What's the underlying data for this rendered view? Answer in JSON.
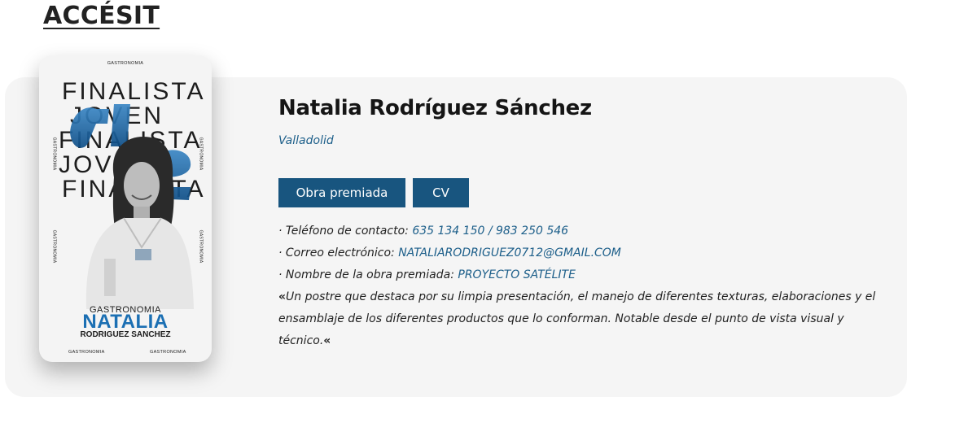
{
  "section": {
    "title": "ACCÉSIT"
  },
  "poster": {
    "top_label": "GASTRONOMIA",
    "words": [
      "FINALISTA",
      "JOVEN",
      "FINALISTA",
      "JOVEN",
      "FINALISTA"
    ],
    "side_label": "GASTRONOMIA",
    "category": "GASTRONOMIA",
    "first_name": "NATALIA",
    "last_name": "RODRIGUEZ SANCHEZ",
    "bottom_left": "GASTRONOMIA",
    "bottom_right": "GASTRONOMIA"
  },
  "person": {
    "name": "Natalia Rodríguez Sánchez",
    "city": "Valladolid"
  },
  "buttons": {
    "obra": "Obra premiada",
    "cv": "CV"
  },
  "details": {
    "phone_label": "· Teléfono de contacto:",
    "phone_value": "635 134 150 / 983 250 546",
    "email_label": "· Correo electrónico:",
    "email_value": "NATALIARODRIGUEZ0712@GMAIL.COM",
    "work_label": "· Nombre de la obra premiada:",
    "work_value": "PROYECTO SATÉLITE"
  },
  "quote": {
    "open": "«",
    "text": "Un postre que destaca por su limpia presentación, el manejo de diferentes texturas, elaboraciones y el ensamblaje de los diferentes productos que lo conforman. Notable desde el punto de vista visual y técnico.",
    "close": "«"
  },
  "colors": {
    "accent": "#18557f",
    "link": "#1d5f8a",
    "card_bg": "#f5f5f5"
  }
}
